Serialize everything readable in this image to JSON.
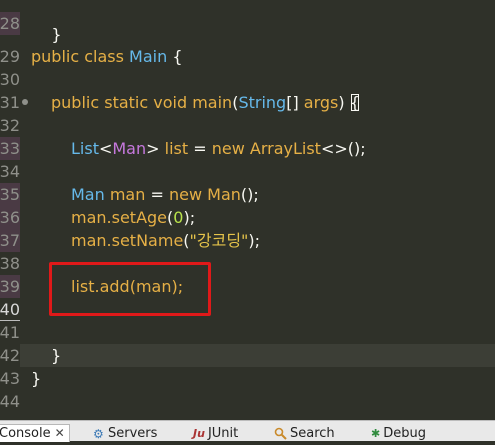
{
  "editor": {
    "gutter": [
      {
        "n": "",
        "hl": false
      },
      {
        "n": "28",
        "hl": true
      },
      {
        "n": "29",
        "hl": false
      },
      {
        "n": "30",
        "hl": false
      },
      {
        "n": "31",
        "hl": false
      },
      {
        "n": "32",
        "hl": false
      },
      {
        "n": "33",
        "hl": true
      },
      {
        "n": "34",
        "hl": false
      },
      {
        "n": "35",
        "hl": true
      },
      {
        "n": "36",
        "hl": true
      },
      {
        "n": "37",
        "hl": true
      },
      {
        "n": "38",
        "hl": false
      },
      {
        "n": "39",
        "hl": true
      },
      {
        "n": "40",
        "hl": false
      },
      {
        "n": "41",
        "hl": false
      },
      {
        "n": "42",
        "hl": false
      },
      {
        "n": "43",
        "hl": false
      },
      {
        "n": "44",
        "hl": false
      }
    ],
    "lines": {
      "l27_brace": "}",
      "l29_public": "public",
      "l29_class": "class",
      "l29_name": "Main",
      "l29_brace": "{",
      "l31_public": "public",
      "l31_static": "static",
      "l31_void": "void",
      "l31_main": "main",
      "l31_paren_open": "(",
      "l31_string": "String",
      "l31_arr": "[]",
      "l31_args": "args",
      "l31_paren_close": ")",
      "l31_brace": "{",
      "l33_list_type": "List",
      "l33_lt": "<",
      "l33_gen": "Man",
      "l33_gt": ">",
      "l33_var": "list",
      "l33_eq": "=",
      "l33_new": "new",
      "l33_arraylist": "ArrayList",
      "l33_diamond": "<>",
      "l33_rest": "();",
      "l35_type": "Man",
      "l35_var": "man",
      "l35_eq": "=",
      "l35_new": "new",
      "l35_ctor": "Man",
      "l35_rest": "();",
      "l36_obj": "man.",
      "l36_meth": "setAge",
      "l36_open": "(",
      "l36_num": "0",
      "l36_close": ");",
      "l37_obj": "man.",
      "l37_meth": "setName",
      "l37_open": "(",
      "l37_str": "\"강코딩\"",
      "l37_close": ");",
      "l39_obj": "list.",
      "l39_meth": "add",
      "l39_args": "(man);",
      "l42_brace": "}",
      "l43_brace": "}"
    }
  },
  "panel": {
    "tabs": [
      {
        "label": "Console",
        "close": "✕"
      },
      {
        "label": "Servers"
      },
      {
        "label": "JUnit",
        "icon_text": "Ju"
      },
      {
        "label": "Search"
      },
      {
        "label": "Debug"
      }
    ]
  },
  "colors": {
    "background": "#2f3129",
    "keyword": "#e6b046",
    "type": "#66b9ea",
    "highlight_box": "#e01919"
  }
}
